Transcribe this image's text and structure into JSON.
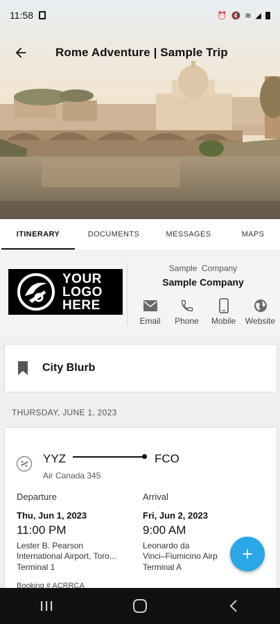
{
  "status_bar": {
    "time": "11:58",
    "icons": [
      "sim-icon",
      "alarm-icon",
      "mute-icon",
      "wifi-icon",
      "signal-icon",
      "battery-icon"
    ]
  },
  "app_bar": {
    "title": "Rome Adventure | Sample Trip",
    "back_icon": "arrow-left-icon"
  },
  "tabs": [
    {
      "label": "ITINERARY",
      "active": true
    },
    {
      "label": "DOCUMENTS",
      "active": false
    },
    {
      "label": "MESSAGES",
      "active": false
    },
    {
      "label": "MAPS",
      "active": false
    }
  ],
  "company": {
    "logo_text": [
      "YOUR",
      "LOGO",
      "HERE"
    ],
    "subtitle": "Sample  Company",
    "name": "Sample Company",
    "contacts": [
      {
        "label": "Email",
        "icon": "email-icon"
      },
      {
        "label": "Phone",
        "icon": "phone-icon"
      },
      {
        "label": "Mobile",
        "icon": "mobile-icon"
      },
      {
        "label": "Website",
        "icon": "globe-icon"
      }
    ]
  },
  "blurb": {
    "label": "City Blurb",
    "icon": "bookmark-icon"
  },
  "date_header": "THURSDAY, JUNE 1, 2023",
  "flight": {
    "origin": "YYZ",
    "destination": "FCO",
    "airline": "Air Canada 345",
    "departure": {
      "label": "Departure",
      "date": "Thu, Jun 1, 2023",
      "time": "11:00 PM",
      "airport_line1": "Lester B. Pearson",
      "airport_line2": "International Airport, Toro...",
      "terminal": "Terminal 1"
    },
    "arrival": {
      "label": "Arrival",
      "date": "Fri, Jun 2, 2023",
      "time": "9:00 AM",
      "airport_line1": "Leonardo da",
      "airport_line2": "Vinci–Fiumicino Airp",
      "terminal": "Terminal A"
    },
    "booking": "Booking # ACRRCA"
  },
  "fab": {
    "symbol": "+"
  },
  "colors": {
    "accent": "#2aa7e4",
    "navbar": "#111111",
    "background": "#eeeff1"
  }
}
